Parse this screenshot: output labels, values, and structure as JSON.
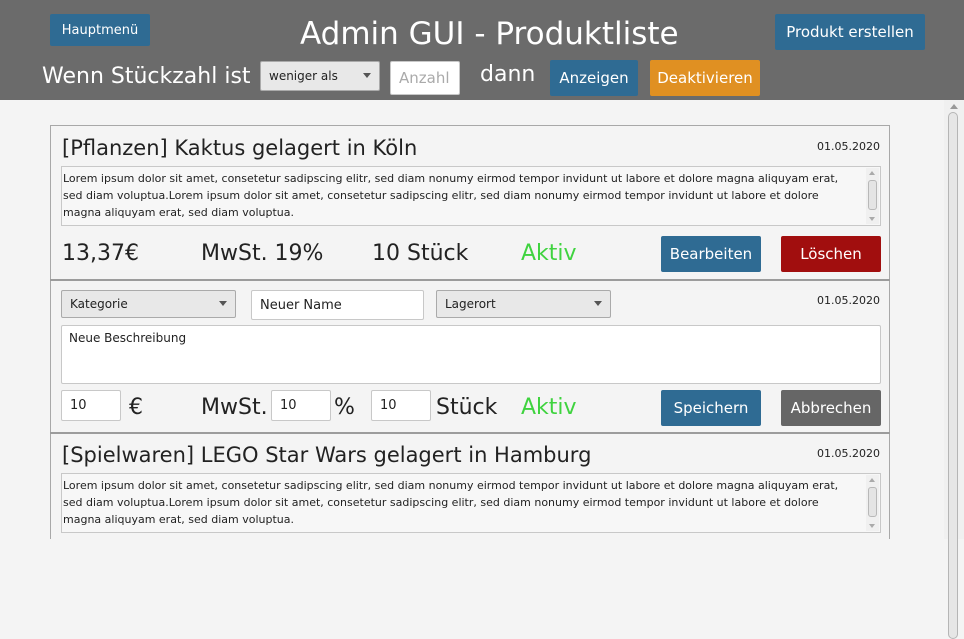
{
  "header": {
    "menu_label": "Hauptmenü",
    "title": "Admin GUI - Produktliste",
    "create_label": "Produkt erstellen",
    "filter_prefix": "Wenn Stückzahl ist",
    "filter_select": "weniger als",
    "amount_placeholder": "Anzahl",
    "filter_then": "dann",
    "show_label": "Anzeigen",
    "deactivate_label": "Deaktivieren"
  },
  "colors": {
    "header_bg": "#6b6b6b",
    "primary": "#2f6b93",
    "warning": "#e09022",
    "danger": "#a10e0e",
    "neutral": "#666666",
    "active": "#3fd33f"
  },
  "products": [
    {
      "title": "[Pflanzen] Kaktus gelagert in Köln",
      "date": "01.05.2020",
      "description": "Lorem ipsum dolor sit amet, consetetur sadipscing elitr, sed diam nonumy eirmod tempor invidunt ut labore et dolore magna aliquyam erat, sed diam voluptua.Lorem ipsum dolor sit amet, consetetur sadipscing elitr, sed diam nonumy eirmod tempor invidunt ut labore et dolore magna aliquyam erat, sed diam voluptua.",
      "price": "13,37€",
      "vat": "MwSt. 19%",
      "stock": "10 Stück",
      "status": "Aktiv",
      "edit_label": "Bearbeiten",
      "delete_label": "Löschen"
    },
    {
      "title": "[Spielwaren] LEGO Star Wars gelagert in Hamburg",
      "date": "01.05.2020",
      "description": "Lorem ipsum dolor sit amet, consetetur sadipscing elitr, sed diam nonumy eirmod tempor invidunt ut labore et dolore magna aliquyam erat, sed diam voluptua.Lorem ipsum dolor sit amet, consetetur sadipscing elitr, sed diam nonumy eirmod tempor invidunt ut labore et dolore magna aliquyam erat, sed diam voluptua."
    }
  ],
  "editor": {
    "category_placeholder": "Kategorie",
    "name_value": "Neuer Name",
    "location_placeholder": "Lagerort",
    "date": "01.05.2020",
    "description_value": "Neue Beschreibung",
    "price_value": "10",
    "currency": "€",
    "vat_label": "MwSt.",
    "vat_value": "10",
    "percent": "%",
    "stock_value": "10",
    "stock_unit": "Stück",
    "status": "Aktiv",
    "save_label": "Speichern",
    "cancel_label": "Abbrechen"
  }
}
